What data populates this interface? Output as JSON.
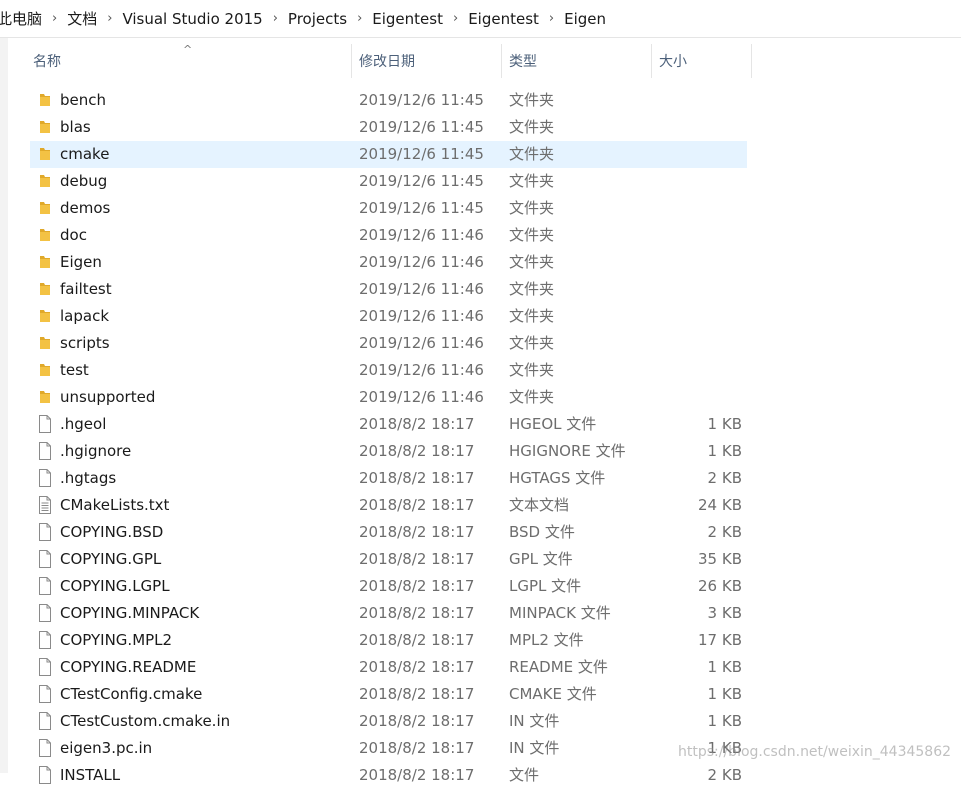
{
  "breadcrumb": [
    "此电脑",
    "文档",
    "Visual Studio 2015",
    "Projects",
    "Eigentest",
    "Eigentest",
    "Eigen"
  ],
  "columns": {
    "name": "名称",
    "date": "修改日期",
    "type": "类型",
    "size": "大小"
  },
  "sort_indicator": "^",
  "files": [
    {
      "icon": "folder-icon",
      "name": "bench",
      "date": "2019/12/6 11:45",
      "type": "文件夹",
      "size": ""
    },
    {
      "icon": "folder-icon",
      "name": "blas",
      "date": "2019/12/6 11:45",
      "type": "文件夹",
      "size": ""
    },
    {
      "icon": "folder-icon",
      "name": "cmake",
      "date": "2019/12/6 11:45",
      "type": "文件夹",
      "size": "",
      "selected": true
    },
    {
      "icon": "folder-icon",
      "name": "debug",
      "date": "2019/12/6 11:45",
      "type": "文件夹",
      "size": ""
    },
    {
      "icon": "folder-icon",
      "name": "demos",
      "date": "2019/12/6 11:45",
      "type": "文件夹",
      "size": ""
    },
    {
      "icon": "folder-icon",
      "name": "doc",
      "date": "2019/12/6 11:46",
      "type": "文件夹",
      "size": ""
    },
    {
      "icon": "folder-icon",
      "name": "Eigen",
      "date": "2019/12/6 11:46",
      "type": "文件夹",
      "size": ""
    },
    {
      "icon": "folder-icon",
      "name": "failtest",
      "date": "2019/12/6 11:46",
      "type": "文件夹",
      "size": ""
    },
    {
      "icon": "folder-icon",
      "name": "lapack",
      "date": "2019/12/6 11:46",
      "type": "文件夹",
      "size": ""
    },
    {
      "icon": "folder-icon",
      "name": "scripts",
      "date": "2019/12/6 11:46",
      "type": "文件夹",
      "size": ""
    },
    {
      "icon": "folder-icon",
      "name": "test",
      "date": "2019/12/6 11:46",
      "type": "文件夹",
      "size": ""
    },
    {
      "icon": "folder-icon",
      "name": "unsupported",
      "date": "2019/12/6 11:46",
      "type": "文件夹",
      "size": ""
    },
    {
      "icon": "file-icon",
      "name": ".hgeol",
      "date": "2018/8/2 18:17",
      "type": "HGEOL 文件",
      "size": "1 KB"
    },
    {
      "icon": "file-icon",
      "name": ".hgignore",
      "date": "2018/8/2 18:17",
      "type": "HGIGNORE 文件",
      "size": "1 KB"
    },
    {
      "icon": "file-icon",
      "name": ".hgtags",
      "date": "2018/8/2 18:17",
      "type": "HGTAGS 文件",
      "size": "2 KB"
    },
    {
      "icon": "text-file-icon",
      "name": "CMakeLists.txt",
      "date": "2018/8/2 18:17",
      "type": "文本文档",
      "size": "24 KB"
    },
    {
      "icon": "file-icon",
      "name": "COPYING.BSD",
      "date": "2018/8/2 18:17",
      "type": "BSD 文件",
      "size": "2 KB"
    },
    {
      "icon": "file-icon",
      "name": "COPYING.GPL",
      "date": "2018/8/2 18:17",
      "type": "GPL 文件",
      "size": "35 KB"
    },
    {
      "icon": "file-icon",
      "name": "COPYING.LGPL",
      "date": "2018/8/2 18:17",
      "type": "LGPL 文件",
      "size": "26 KB"
    },
    {
      "icon": "file-icon",
      "name": "COPYING.MINPACK",
      "date": "2018/8/2 18:17",
      "type": "MINPACK 文件",
      "size": "3 KB"
    },
    {
      "icon": "file-icon",
      "name": "COPYING.MPL2",
      "date": "2018/8/2 18:17",
      "type": "MPL2 文件",
      "size": "17 KB"
    },
    {
      "icon": "file-icon",
      "name": "COPYING.README",
      "date": "2018/8/2 18:17",
      "type": "README 文件",
      "size": "1 KB"
    },
    {
      "icon": "file-icon",
      "name": "CTestConfig.cmake",
      "date": "2018/8/2 18:17",
      "type": "CMAKE 文件",
      "size": "1 KB"
    },
    {
      "icon": "file-icon",
      "name": "CTestCustom.cmake.in",
      "date": "2018/8/2 18:17",
      "type": "IN 文件",
      "size": "1 KB"
    },
    {
      "icon": "file-icon",
      "name": "eigen3.pc.in",
      "date": "2018/8/2 18:17",
      "type": "IN 文件",
      "size": "1 KB"
    },
    {
      "icon": "file-icon",
      "name": "INSTALL",
      "date": "2018/8/2 18:17",
      "type": "文件",
      "size": "2 KB"
    }
  ],
  "watermark": "https://blog.csdn.net/weixin_44345862",
  "colors": {
    "folder": "#f3c244",
    "selection": "#e5f3ff",
    "header_text": "#4c607a",
    "meta_text": "#6d6d6d"
  }
}
